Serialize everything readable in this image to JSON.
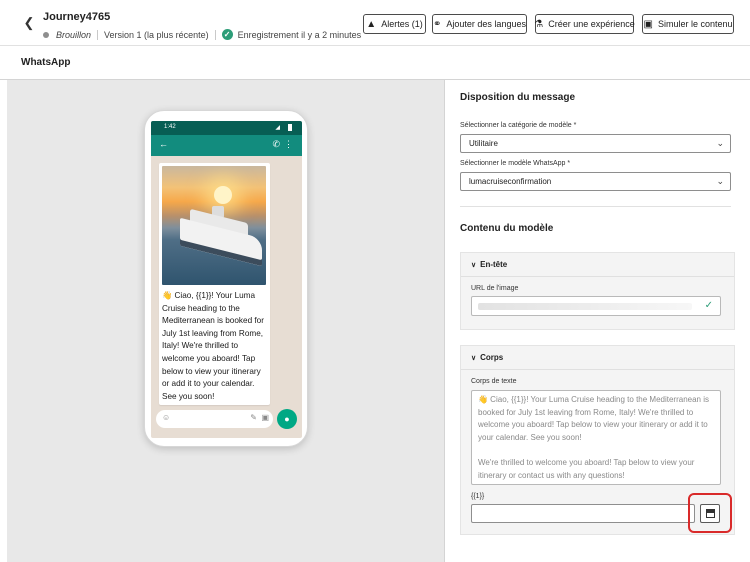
{
  "header": {
    "back_icon": "chevron-left-icon",
    "journey_title": "Journey4765",
    "status": "Brouillon",
    "version": "Version 1 (la plus récente)",
    "saved": "Enregistrement il y a 2 minutes",
    "buttons": {
      "alerts": "Alertes (1)",
      "add_languages": "Ajouter des langues",
      "create_experience": "Créer une expérience",
      "simulate": "Simuler le contenu"
    }
  },
  "subheader": {
    "title": "WhatsApp"
  },
  "preview": {
    "status_time": "1:42",
    "message": "👋 Ciao, {{1}}! Your Luma Cruise heading to the Mediterranean is booked for July 1st leaving from Rome, Italy! We're thrilled to welcome you aboard! Tap below to view your itinerary or add it to your calendar. See you soon!"
  },
  "panel": {
    "layout_title": "Disposition du message",
    "category_label": "Sélectionner la catégorie de modèle",
    "category_value": "Utilitaire",
    "template_label": "Sélectionner le modèle WhatsApp",
    "template_value": "lumacruiseconfirmation",
    "content_title": "Contenu du modèle",
    "header_card": {
      "title": "En-tête",
      "url_label": "URL de l'image"
    },
    "body_card": {
      "title": "Corps",
      "body_label": "Corps de texte",
      "body_text_1": "👋 Ciao, {{1}}! Your Luma Cruise heading to the Mediterranean is booked for July 1st leaving from Rome, Italy! We're thrilled to welcome you aboard! Tap below to view your itinerary or add it to your calendar. See you soon!",
      "body_text_2": "We're thrilled to welcome you aboard! Tap below to view your itinerary or contact us with any questions!",
      "var_label": "{{1}}",
      "var_value": ""
    },
    "required_mark": "*"
  },
  "colors": {
    "whatsapp_dark": "#075e54",
    "whatsapp_teal": "#128c7e",
    "whatsapp_green": "#00a884",
    "success": "#2d9d78",
    "highlight": "#d92a2a"
  }
}
